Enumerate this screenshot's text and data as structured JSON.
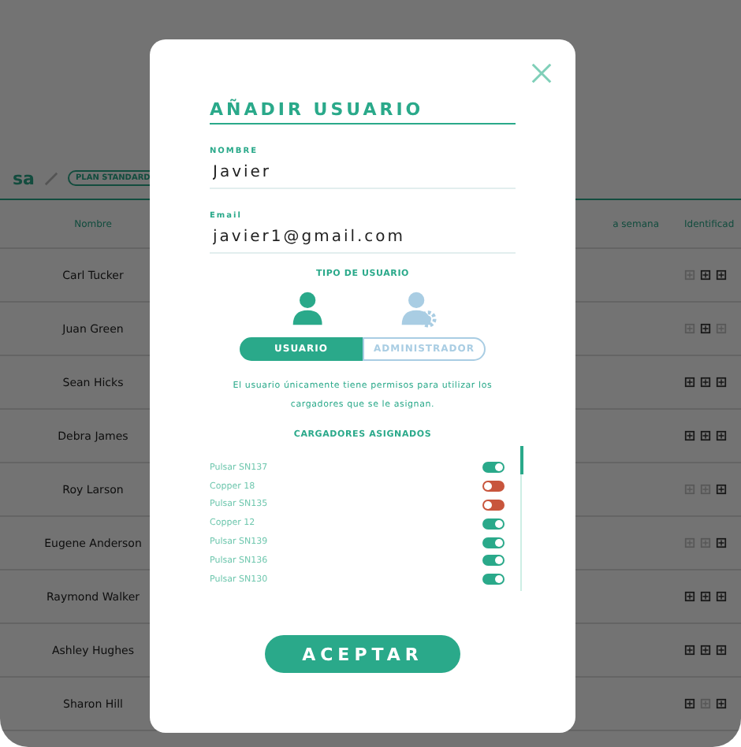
{
  "background": {
    "company_fragment": "sa",
    "plan_badge": "PLAN STANDARD",
    "columns": [
      "Nombre",
      "a semana",
      "Identificad"
    ],
    "rows": [
      {
        "name": "Carl Tucker",
        "icons": [
          false,
          true,
          true
        ]
      },
      {
        "name": "Juan Green",
        "icons": [
          false,
          true,
          false
        ]
      },
      {
        "name": "Sean Hicks",
        "icons": [
          true,
          true,
          true
        ]
      },
      {
        "name": "Debra James",
        "icons": [
          true,
          true,
          true
        ]
      },
      {
        "name": "Roy Larson",
        "icons": [
          false,
          false,
          true
        ]
      },
      {
        "name": "Eugene Anderson",
        "icons": [
          false,
          false,
          true
        ]
      },
      {
        "name": "Raymond Walker",
        "icons": [
          true,
          true,
          true
        ]
      },
      {
        "name": "Ashley Hughes",
        "icons": [
          true,
          true,
          true
        ]
      },
      {
        "name": "Sharon Hill",
        "icons": [
          true,
          false,
          true
        ]
      }
    ]
  },
  "modal": {
    "title": "AÑADIR USUARIO",
    "fields": [
      {
        "label": "NOMBRE",
        "value": "Javier"
      },
      {
        "label": "Email",
        "value": "javier1@gmail.com"
      }
    ],
    "user_type_label": "TIPO DE USUARIO",
    "user_types": [
      {
        "kind": "user",
        "label": "USUARIO",
        "selected": true
      },
      {
        "kind": "admin",
        "label": "ADMINISTRADOR",
        "selected": false
      }
    ],
    "description": "El usuario únicamente tiene permisos para utilizar los cargadores que se le asignan.",
    "chargers_label": "CARGADORES ASIGNADOS",
    "chargers": [
      {
        "name": "Pulsar SN137",
        "on": true
      },
      {
        "name": "Copper 18",
        "on": false
      },
      {
        "name": "Pulsar SN135",
        "on": false
      },
      {
        "name": "Copper 12",
        "on": true
      },
      {
        "name": "Pulsar SN139",
        "on": true
      },
      {
        "name": "Pulsar SN136",
        "on": true
      },
      {
        "name": "Pulsar SN130",
        "on": true
      }
    ],
    "accept_button": "ACEPTAR"
  }
}
